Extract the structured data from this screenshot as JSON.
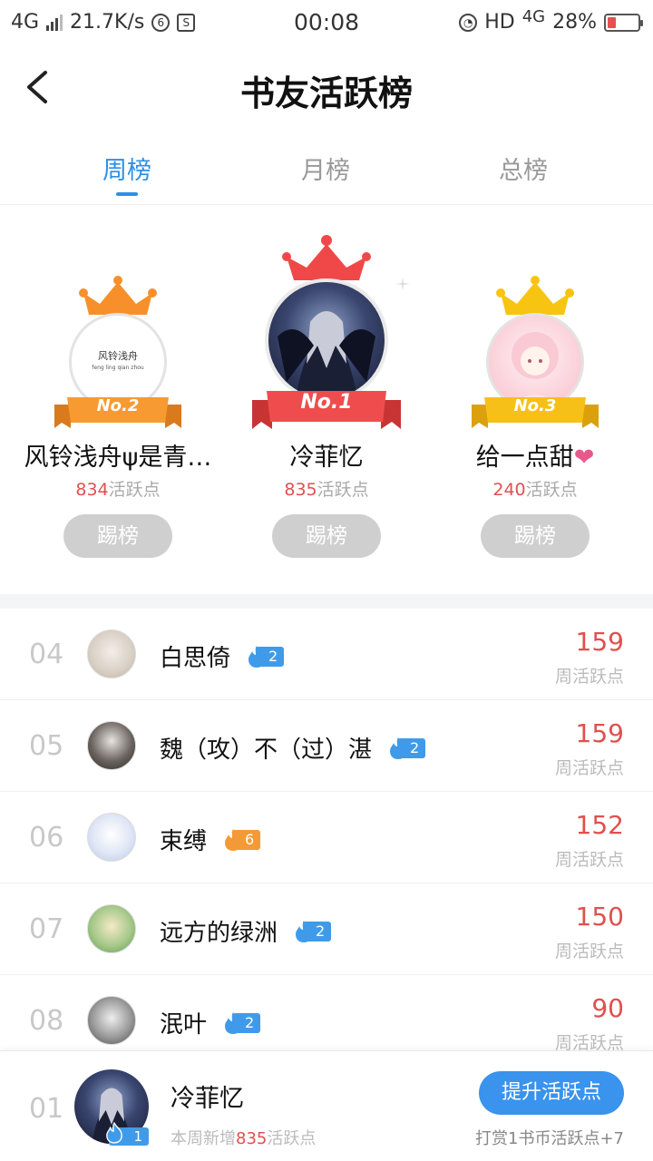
{
  "status_bar": {
    "network": "4G",
    "speed": "21.7K/s",
    "time": "00:08",
    "hd": "HD",
    "net2": "4G",
    "battery": "28%",
    "battery_level": 0.28
  },
  "header": {
    "title": "书友活跃榜"
  },
  "tabs": [
    {
      "label": "周榜",
      "active": true
    },
    {
      "label": "月榜",
      "active": false
    },
    {
      "label": "总榜",
      "active": false
    }
  ],
  "podium": [
    {
      "badge": "No.2",
      "name": "风铃浅舟ψ是青…",
      "score": "834",
      "score_unit": "活跃点",
      "button": "踢榜",
      "avatar_text_1": "风铃浅舟",
      "avatar_text_2": "feng ling qian zhou",
      "crown_color": "#f7902a",
      "ribbon_color": "#f79a32"
    },
    {
      "badge": "No.1",
      "name": "冷菲忆",
      "score": "835",
      "score_unit": "活跃点",
      "button": "踢榜",
      "crown_color": "#f04848",
      "ribbon_color": "#ef4d4d"
    },
    {
      "badge": "No.3",
      "name": "给一点甜",
      "name_suffix": "❤",
      "score": "240",
      "score_unit": "活跃点",
      "button": "踢榜",
      "crown_color": "#f7c411",
      "ribbon_color": "#f7c018"
    }
  ],
  "list": [
    {
      "rank": "04",
      "name": "白思倚",
      "fire_level": "2",
      "fire_color": "blue",
      "score": "159",
      "sub": "周活跃点"
    },
    {
      "rank": "05",
      "name": "魏（攻）不（过）湛",
      "fire_level": "2",
      "fire_color": "blue",
      "score": "159",
      "sub": "周活跃点"
    },
    {
      "rank": "06",
      "name": "束缚",
      "fire_level": "6",
      "fire_color": "orange",
      "score": "152",
      "sub": "周活跃点"
    },
    {
      "rank": "07",
      "name": "远方的绿洲",
      "fire_level": "2",
      "fire_color": "blue",
      "score": "150",
      "sub": "周活跃点"
    },
    {
      "rank": "08",
      "name": "泯叶",
      "fire_level": "2",
      "fire_color": "blue",
      "score": "90",
      "sub": "周活跃点"
    }
  ],
  "me": {
    "rank": "01",
    "name": "冷菲忆",
    "fire_level": "1",
    "sub_prefix": "本周新增",
    "sub_num": "835",
    "sub_suffix": "活跃点",
    "button": "提升活跃点",
    "hint": "打赏1书币活跃点+7"
  }
}
